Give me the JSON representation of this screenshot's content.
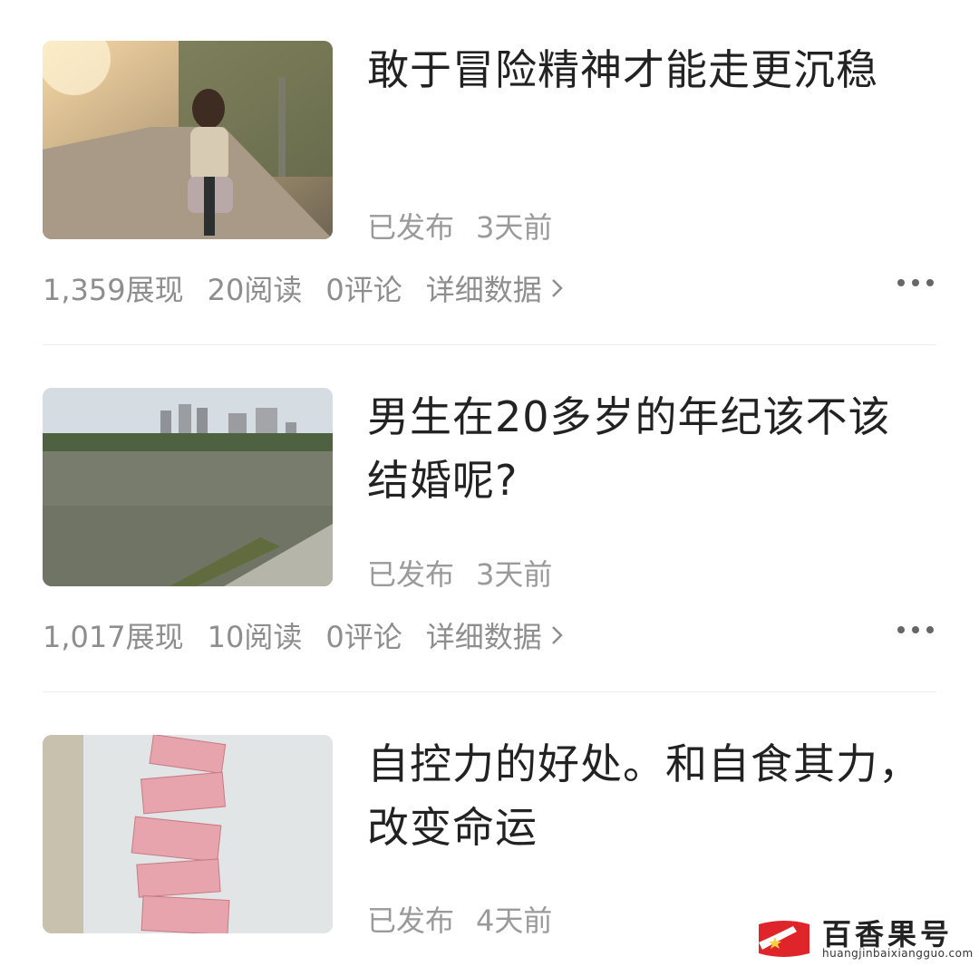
{
  "articles": [
    {
      "title": "敢于冒险精神才能走更沉稳",
      "status": "已发布",
      "time": "3天前",
      "impressions": "1,359展现",
      "reads": "20阅读",
      "comments": "0评论",
      "detail": "详细数据"
    },
    {
      "title": "男生在20多岁的年纪该不该结婚呢?",
      "status": "已发布",
      "time": "3天前",
      "impressions": "1,017展现",
      "reads": "10阅读",
      "comments": "0评论",
      "detail": "详细数据"
    },
    {
      "title": "自控力的好处。和自食其力，改变命运",
      "status": "已发布",
      "time": "4天前"
    }
  ],
  "watermark": {
    "name": "百香果号",
    "url": "huangjinbaixiangguo.com"
  }
}
